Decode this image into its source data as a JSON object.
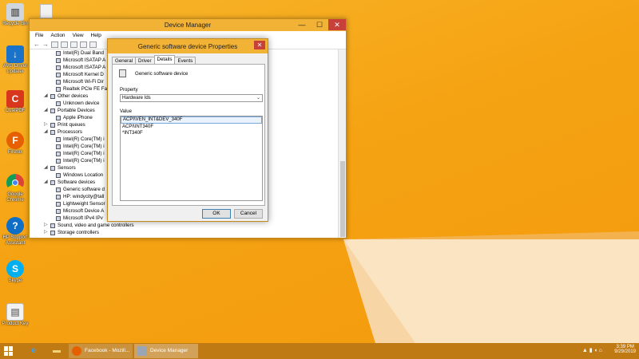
{
  "desktop": {
    "icons": [
      {
        "label": "Recycle Bin",
        "color": "#cfd6dd",
        "glyph": "🗑"
      },
      {
        "label": "AVG Driver Updater",
        "color": "#1a73c9",
        "glyph": "↓"
      },
      {
        "label": "CutePDF",
        "color": "#d9361e",
        "glyph": "C"
      },
      {
        "label": "Firefox",
        "color": "#e66000",
        "glyph": "F"
      },
      {
        "label": "Google Chrome",
        "color": "#2f9e44",
        "glyph": "◉"
      },
      {
        "label": "HP Support Assistant",
        "color": "#0f6fc6",
        "glyph": "?"
      },
      {
        "label": "Skype",
        "color": "#00aff0",
        "glyph": "S"
      },
      {
        "label": "Product Key",
        "color": "#f2f2f2",
        "glyph": "▤"
      }
    ]
  },
  "devmgr": {
    "title": "Device Manager",
    "menu": [
      "File",
      "Action",
      "View",
      "Help"
    ],
    "minimize": "—",
    "maximize": "☐",
    "close": "✕",
    "tree": [
      {
        "indent": 2,
        "expander": "",
        "label": "Intel(R) Dual Band"
      },
      {
        "indent": 2,
        "expander": "",
        "label": "Microsoft ISATAP A"
      },
      {
        "indent": 2,
        "expander": "",
        "label": "Microsoft ISATAP A"
      },
      {
        "indent": 2,
        "expander": "",
        "label": "Microsoft Kernel D"
      },
      {
        "indent": 2,
        "expander": "",
        "label": "Microsoft Wi-Fi Dir"
      },
      {
        "indent": 2,
        "expander": "",
        "label": "Realtek PCIe FE Far"
      },
      {
        "indent": 1,
        "expander": "◢",
        "label": "Other devices"
      },
      {
        "indent": 2,
        "expander": "",
        "label": "Unknown device"
      },
      {
        "indent": 1,
        "expander": "◢",
        "label": "Portable Devices"
      },
      {
        "indent": 2,
        "expander": "",
        "label": "Apple iPhone"
      },
      {
        "indent": 1,
        "expander": "▷",
        "label": "Print queues"
      },
      {
        "indent": 1,
        "expander": "◢",
        "label": "Processors"
      },
      {
        "indent": 2,
        "expander": "",
        "label": "Intel(R) Core(TM) i"
      },
      {
        "indent": 2,
        "expander": "",
        "label": "Intel(R) Core(TM) i"
      },
      {
        "indent": 2,
        "expander": "",
        "label": "Intel(R) Core(TM) i"
      },
      {
        "indent": 2,
        "expander": "",
        "label": "Intel(R) Core(TM) i"
      },
      {
        "indent": 1,
        "expander": "◢",
        "label": "Sensors"
      },
      {
        "indent": 2,
        "expander": "",
        "label": "Windows Location"
      },
      {
        "indent": 1,
        "expander": "◢",
        "label": "Software devices"
      },
      {
        "indent": 2,
        "expander": "",
        "label": "Generic software d"
      },
      {
        "indent": 2,
        "expander": "",
        "label": "HP: windycity@tall"
      },
      {
        "indent": 2,
        "expander": "",
        "label": "Lightweight Sensor"
      },
      {
        "indent": 2,
        "expander": "",
        "label": "Microsoft Device A"
      },
      {
        "indent": 2,
        "expander": "",
        "label": "Microsoft IPv4 IPv"
      },
      {
        "indent": 1,
        "expander": "▷",
        "label": "Sound, video and game controllers"
      },
      {
        "indent": 1,
        "expander": "▷",
        "label": "Storage controllers"
      }
    ]
  },
  "props": {
    "title": "Generic software device Properties",
    "close": "✕",
    "tabs": [
      "General",
      "Driver",
      "Details",
      "Events"
    ],
    "device_name": "Generic software device",
    "property_label": "Property",
    "property_value": "Hardware Ids",
    "value_label": "Value",
    "values": [
      "ACPI\\VEN_INT&DEV_340F",
      "ACPI\\INT340F",
      "*INT340F"
    ],
    "ok": "OK",
    "cancel": "Cancel"
  },
  "taskbar": {
    "firefox_task": "Facebook - Mozill...",
    "devmgr_task": "Device Manager",
    "tray_icons": "▲ ▮ ◖ ⌂",
    "time": "3:39 PM",
    "date": "9/29/2019"
  }
}
